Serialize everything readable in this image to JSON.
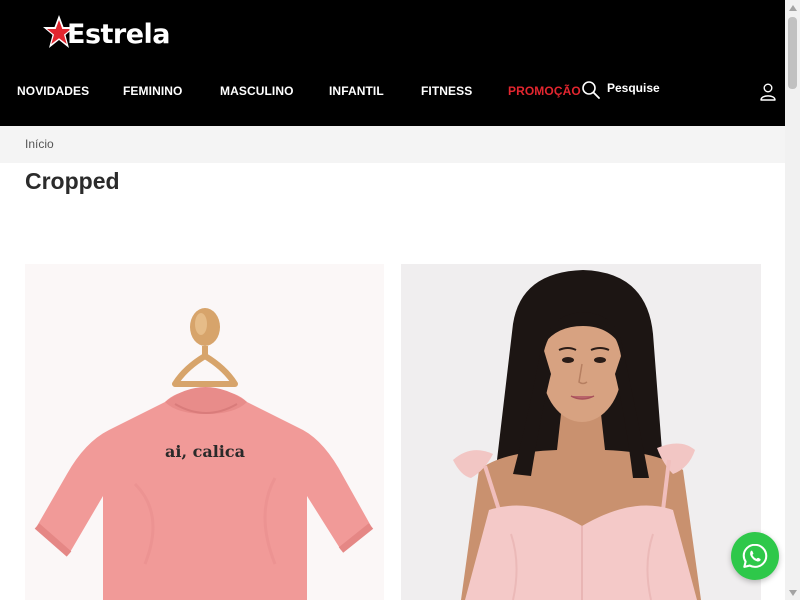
{
  "brand": {
    "name": "Estrela",
    "accent_color": "#e3262f"
  },
  "nav": {
    "items": [
      {
        "label": "NOVIDADES"
      },
      {
        "label": "FEMININO"
      },
      {
        "label": "MASCULINO"
      },
      {
        "label": "INFANTIL"
      },
      {
        "label": "FITNESS"
      },
      {
        "label": "PROMOÇÃO",
        "color": "#e3262f"
      }
    ],
    "search_label": "Pesquise",
    "search_icon": "search-icon",
    "account_icon": "user-icon"
  },
  "breadcrumb": {
    "items": [
      {
        "label": "Início"
      }
    ]
  },
  "page": {
    "title": "Cropped"
  },
  "products": [
    {
      "image": "pink-cropped-tshirt-on-hanger",
      "print_text": "ai, calica"
    },
    {
      "image": "model-wearing-pink-ruffle-strap-cropped-top"
    }
  ],
  "floating": {
    "whatsapp_icon": "whatsapp-icon",
    "color": "#2ec84a"
  }
}
